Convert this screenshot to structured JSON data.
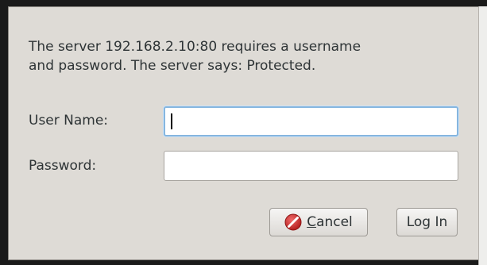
{
  "dialog": {
    "message_line1": "The server 192.168.2.10:80 requires a username",
    "message_line2": "and password. The server says: Protected.",
    "username_label": "User Name:",
    "username_value": "",
    "password_label": "Password:",
    "password_value": ""
  },
  "buttons": {
    "cancel_mnemonic": "C",
    "cancel_rest": "ancel",
    "cancel_icon": "cancel-icon",
    "login_label": "Log In"
  },
  "colors": {
    "dialog_bg": "#dedbd6",
    "focus_border": "#86b6df",
    "cancel_icon_red": "#cc2a2a"
  }
}
